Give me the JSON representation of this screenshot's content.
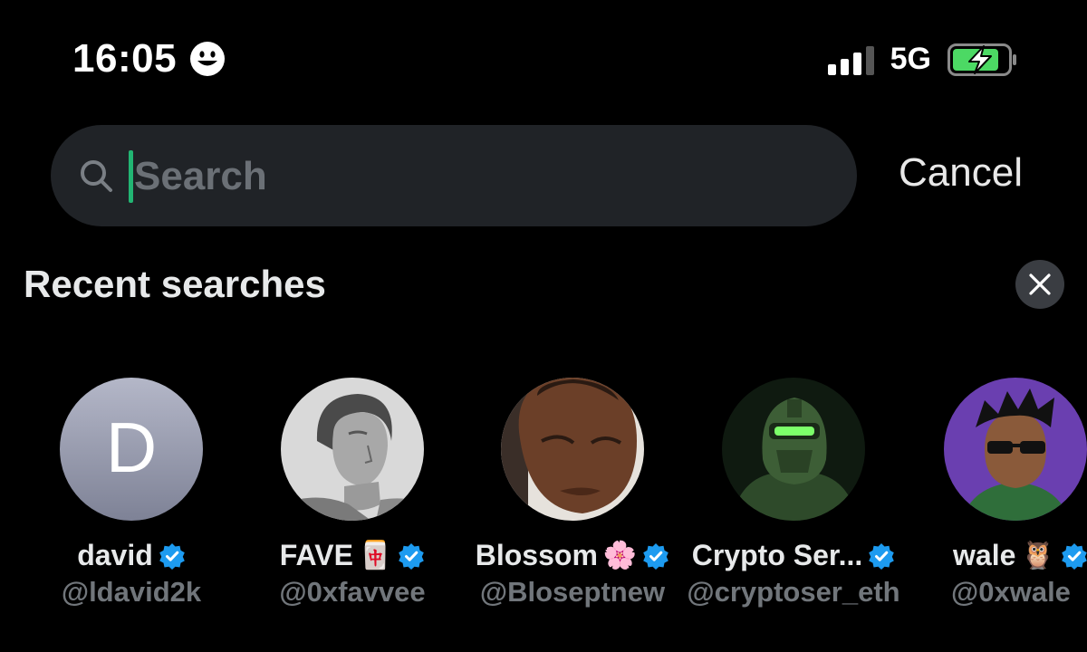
{
  "status_bar": {
    "time": "16:05",
    "network": "5G"
  },
  "search": {
    "placeholder": "Search",
    "value": "",
    "cancel_label": "Cancel"
  },
  "recent": {
    "title": "Recent searches",
    "items": [
      {
        "name": "david",
        "name_suffix": "",
        "handle": "@ldavid2k",
        "avatar_letter": "D",
        "verified": true
      },
      {
        "name": "FAVE",
        "name_suffix": "🀄",
        "handle": "@0xfavvee",
        "verified": true
      },
      {
        "name": "Blossom",
        "name_suffix": "🌸",
        "handle": "@Bloseptnew",
        "verified": true
      },
      {
        "name": "Crypto Ser...",
        "name_suffix": "",
        "handle": "@cryptoser_eth",
        "verified": true
      },
      {
        "name": "wale",
        "name_suffix": "🦉",
        "handle": "@0xwale",
        "verified": true
      }
    ]
  },
  "colors": {
    "background": "#000000",
    "search_bg": "#202327",
    "caret": "#22b573",
    "verified": "#1d9bf0",
    "handle": "#71767b",
    "battery_fill": "#4cd964"
  },
  "icons": {
    "smiley": "smiley-icon",
    "signal": "signal-icon",
    "battery": "battery-charging-icon",
    "search": "search-icon",
    "close": "close-icon",
    "verified": "verified-badge-icon"
  }
}
